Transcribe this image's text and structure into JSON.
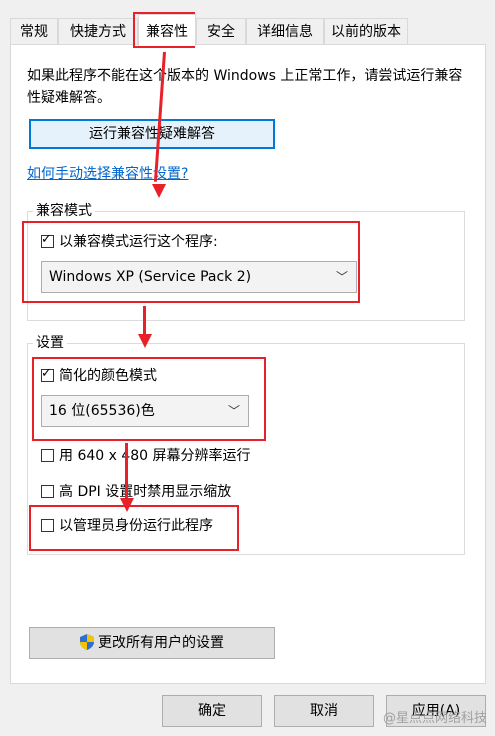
{
  "tabs": [
    {
      "label": "常规"
    },
    {
      "label": "快捷方式"
    },
    {
      "label": "兼容性"
    },
    {
      "label": "安全"
    },
    {
      "label": "详细信息"
    },
    {
      "label": "以前的版本"
    }
  ],
  "intro_text": "如果此程序不能在这个版本的 Windows 上正常工作，请尝试运行兼容性疑难解答。",
  "troubleshoot_button": "运行兼容性疑难解答",
  "manual_link": "如何手动选择兼容性设置?",
  "compat_mode": {
    "legend": "兼容模式",
    "checkbox_label": "以兼容模式运行这个程序:",
    "checked": true,
    "selected_os": "Windows XP (Service Pack 2)"
  },
  "settings": {
    "legend": "设置",
    "reduced_color": {
      "label": "简化的颜色模式",
      "checked": true
    },
    "color_value": "16 位(65536)色",
    "res_640": {
      "label": "用 640 x 480 屏幕分辨率运行",
      "checked": false
    },
    "high_dpi": {
      "label": "高 DPI 设置时禁用显示缩放",
      "checked": false
    },
    "run_admin": {
      "label": "以管理员身份运行此程序",
      "checked": false
    }
  },
  "all_users_button": "更改所有用户的设置",
  "footer": {
    "ok": "确定",
    "cancel": "取消",
    "apply": "应用(A)"
  },
  "watermark": "@星点点网络科技",
  "colors": {
    "annotation_red": "#e8202a",
    "link_blue": "#0066cc",
    "focus_blue": "#0078d7"
  }
}
